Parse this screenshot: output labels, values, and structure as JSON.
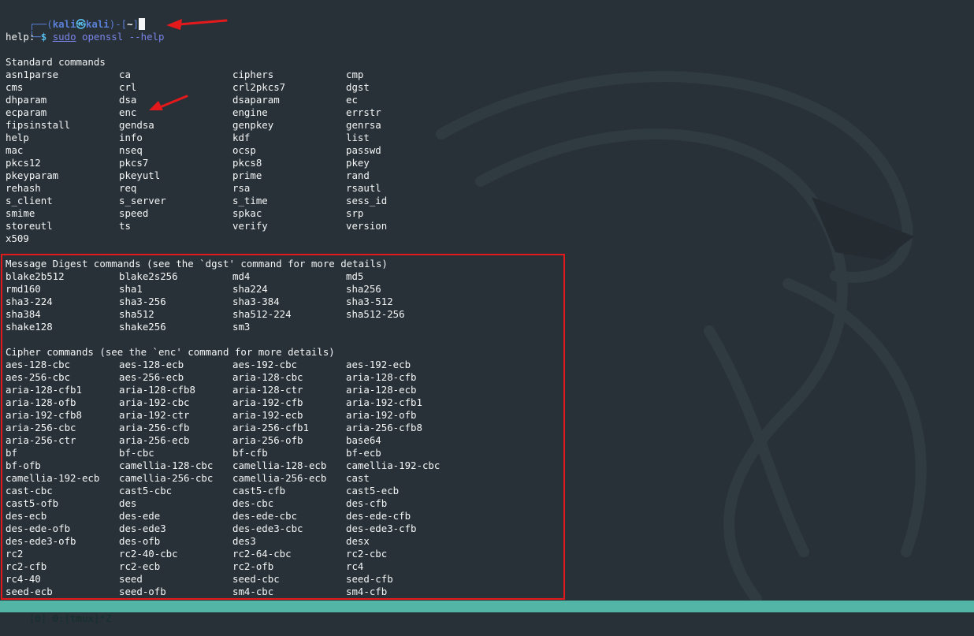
{
  "prompt": {
    "corner_top": "┌──(",
    "user": "kali",
    "at_icon": "㉿",
    "host": "kali",
    "mid": ")-[",
    "cwd": "~",
    "end": "]",
    "corner_bottom": "└─",
    "dollar": "$",
    "cmd_sudo": "sudo",
    "cmd_rest": " openssl ",
    "cmd_flag": "--help"
  },
  "help_label": "help:",
  "standard": {
    "header": "Standard commands",
    "rows": [
      [
        "asn1parse",
        "ca",
        "ciphers",
        "cmp"
      ],
      [
        "cms",
        "crl",
        "crl2pkcs7",
        "dgst"
      ],
      [
        "dhparam",
        "dsa",
        "dsaparam",
        "ec"
      ],
      [
        "ecparam",
        "enc",
        "engine",
        "errstr"
      ],
      [
        "fipsinstall",
        "gendsa",
        "genpkey",
        "genrsa"
      ],
      [
        "help",
        "info",
        "kdf",
        "list"
      ],
      [
        "mac",
        "nseq",
        "ocsp",
        "passwd"
      ],
      [
        "pkcs12",
        "pkcs7",
        "pkcs8",
        "pkey"
      ],
      [
        "pkeyparam",
        "pkeyutl",
        "prime",
        "rand"
      ],
      [
        "rehash",
        "req",
        "rsa",
        "rsautl"
      ],
      [
        "s_client",
        "s_server",
        "s_time",
        "sess_id"
      ],
      [
        "smime",
        "speed",
        "spkac",
        "srp"
      ],
      [
        "storeutl",
        "ts",
        "verify",
        "version"
      ],
      [
        "x509"
      ]
    ]
  },
  "digest": {
    "header": "Message Digest commands (see the `dgst' command for more details)",
    "rows": [
      [
        "blake2b512",
        "blake2s256",
        "md4",
        "md5"
      ],
      [
        "rmd160",
        "sha1",
        "sha224",
        "sha256"
      ],
      [
        "sha3-224",
        "sha3-256",
        "sha3-384",
        "sha3-512"
      ],
      [
        "sha384",
        "sha512",
        "sha512-224",
        "sha512-256"
      ],
      [
        "shake128",
        "shake256",
        "sm3"
      ]
    ]
  },
  "cipher": {
    "header": "Cipher commands (see the `enc' command for more details)",
    "rows": [
      [
        "aes-128-cbc",
        "aes-128-ecb",
        "aes-192-cbc",
        "aes-192-ecb"
      ],
      [
        "aes-256-cbc",
        "aes-256-ecb",
        "aria-128-cbc",
        "aria-128-cfb"
      ],
      [
        "aria-128-cfb1",
        "aria-128-cfb8",
        "aria-128-ctr",
        "aria-128-ecb"
      ],
      [
        "aria-128-ofb",
        "aria-192-cbc",
        "aria-192-cfb",
        "aria-192-cfb1"
      ],
      [
        "aria-192-cfb8",
        "aria-192-ctr",
        "aria-192-ecb",
        "aria-192-ofb"
      ],
      [
        "aria-256-cbc",
        "aria-256-cfb",
        "aria-256-cfb1",
        "aria-256-cfb8"
      ],
      [
        "aria-256-ctr",
        "aria-256-ecb",
        "aria-256-ofb",
        "base64"
      ],
      [
        "bf",
        "bf-cbc",
        "bf-cfb",
        "bf-ecb"
      ],
      [
        "bf-ofb",
        "camellia-128-cbc",
        "camellia-128-ecb",
        "camellia-192-cbc"
      ],
      [
        "camellia-192-ecb",
        "camellia-256-cbc",
        "camellia-256-ecb",
        "cast"
      ],
      [
        "cast-cbc",
        "cast5-cbc",
        "cast5-cfb",
        "cast5-ecb"
      ],
      [
        "cast5-ofb",
        "des",
        "des-cbc",
        "des-cfb"
      ],
      [
        "des-ecb",
        "des-ede",
        "des-ede-cbc",
        "des-ede-cfb"
      ],
      [
        "des-ede-ofb",
        "des-ede3",
        "des-ede3-cbc",
        "des-ede3-cfb"
      ],
      [
        "des-ede3-ofb",
        "des-ofb",
        "des3",
        "desx"
      ],
      [
        "rc2",
        "rc2-40-cbc",
        "rc2-64-cbc",
        "rc2-cbc"
      ],
      [
        "rc2-cfb",
        "rc2-ecb",
        "rc2-ofb",
        "rc4"
      ],
      [
        "rc4-40",
        "seed",
        "seed-cbc",
        "seed-cfb"
      ],
      [
        "seed-ecb",
        "seed-ofb",
        "sm4-cbc",
        "sm4-cfb"
      ]
    ]
  },
  "statusbar": {
    "text": "[0] 0:[tmux]*Z"
  },
  "colors": {
    "background": "#283137",
    "text": "#f4f6f7",
    "prompt_blue": "#5a7fd6",
    "prompt_cyan": "#57b9e6",
    "status_teal": "#52b5a5",
    "annotation_red": "#e3191c"
  },
  "icons": {
    "background": "kali-dragon-icon",
    "annotations": "red-arrow-icon"
  }
}
